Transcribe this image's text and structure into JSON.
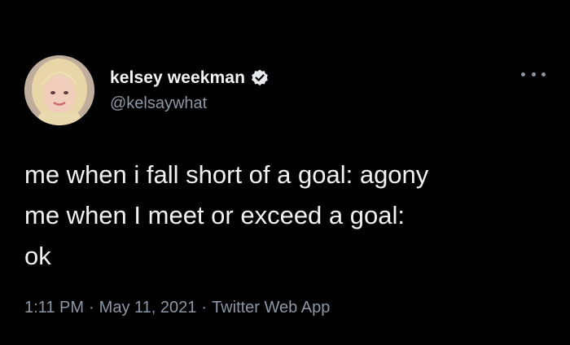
{
  "author": {
    "display_name": "kelsey weekman",
    "handle": "@kelsaywhat",
    "verified": true,
    "avatar_icon": "avatar-photo"
  },
  "tweet": {
    "lines": [
      "me when i fall short of a goal: agony",
      "me when I meet or exceed a goal:",
      "ok"
    ]
  },
  "meta": {
    "time": "1:11 PM",
    "separator": "·",
    "date": "May 11, 2021",
    "source": "Twitter Web App"
  },
  "icons": {
    "more": "more-options-icon",
    "verified": "verified-badge-icon"
  },
  "colors": {
    "background": "#000000",
    "text_primary": "#f2f2f2",
    "text_secondary": "#8b98a5",
    "verified_badge": "#e7e9ea"
  }
}
